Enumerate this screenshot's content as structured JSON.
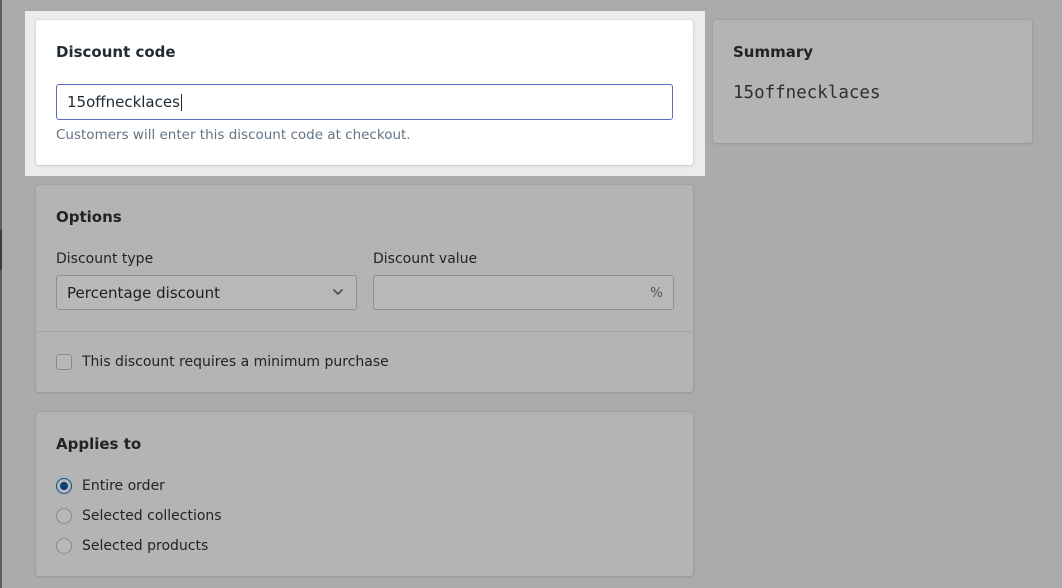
{
  "discount_code_card": {
    "title": "Discount code",
    "input_value": "15offnecklaces",
    "help_text": "Customers will enter this discount code at checkout."
  },
  "summary_card": {
    "title": "Summary",
    "code": "15offnecklaces"
  },
  "options_card": {
    "title": "Options",
    "discount_type_label": "Discount type",
    "discount_type_selected": "Percentage discount",
    "discount_value_label": "Discount value",
    "discount_value": "",
    "discount_value_suffix": "%",
    "minimum_purchase_label": "This discount requires a minimum purchase",
    "minimum_purchase_checked": false
  },
  "applies_to_card": {
    "title": "Applies to",
    "options": [
      {
        "label": "Entire order",
        "selected": true
      },
      {
        "label": "Selected collections",
        "selected": false
      },
      {
        "label": "Selected products",
        "selected": false
      }
    ]
  },
  "colors": {
    "overlay": "#ababab",
    "input_focus_border": "#5c6ac4",
    "radio_selected": "#0d3f73"
  },
  "icons": {
    "select_chevron": "chevron-down-icon"
  }
}
